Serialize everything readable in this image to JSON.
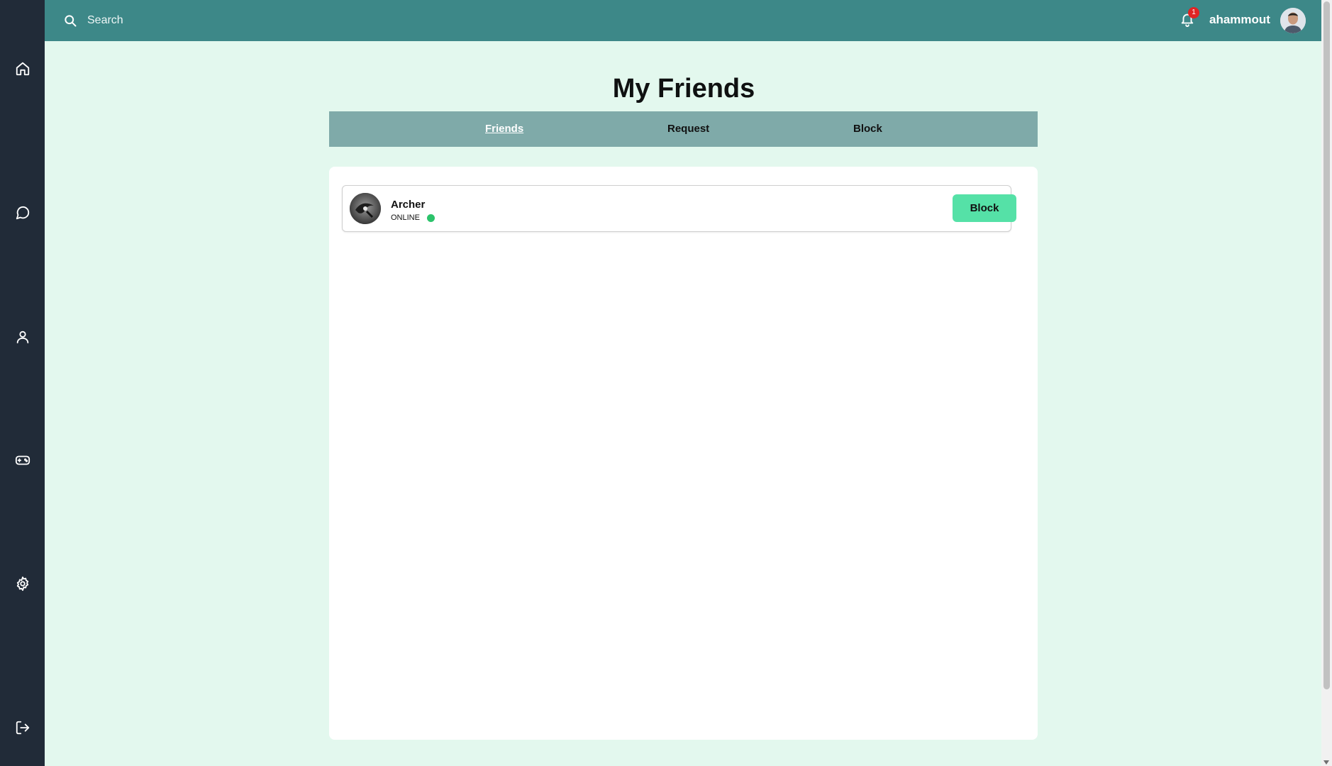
{
  "sidebar": {
    "items": [
      {
        "icon": "home-icon"
      },
      {
        "icon": "chat-icon"
      },
      {
        "icon": "user-icon"
      },
      {
        "icon": "gamepad-icon"
      },
      {
        "icon": "settings-icon"
      },
      {
        "icon": "logout-icon"
      }
    ]
  },
  "header": {
    "search_placeholder": "Search",
    "notification_count": "1",
    "username": "ahammout"
  },
  "main": {
    "title": "My Friends",
    "tabs": [
      {
        "label": "Friends",
        "active": true
      },
      {
        "label": "Request",
        "active": false
      },
      {
        "label": "Block",
        "active": false
      }
    ],
    "friends": [
      {
        "name": "Archer",
        "status": "ONLINE",
        "action_label": "Block"
      }
    ]
  },
  "colors": {
    "sidebar": "#212b38",
    "topbar": "#3d8888",
    "background": "#e3f8ee",
    "tabbar": "#7faaa9",
    "block_button": "#55e1a7",
    "online": "#2cc36b",
    "badge": "#e02424"
  }
}
